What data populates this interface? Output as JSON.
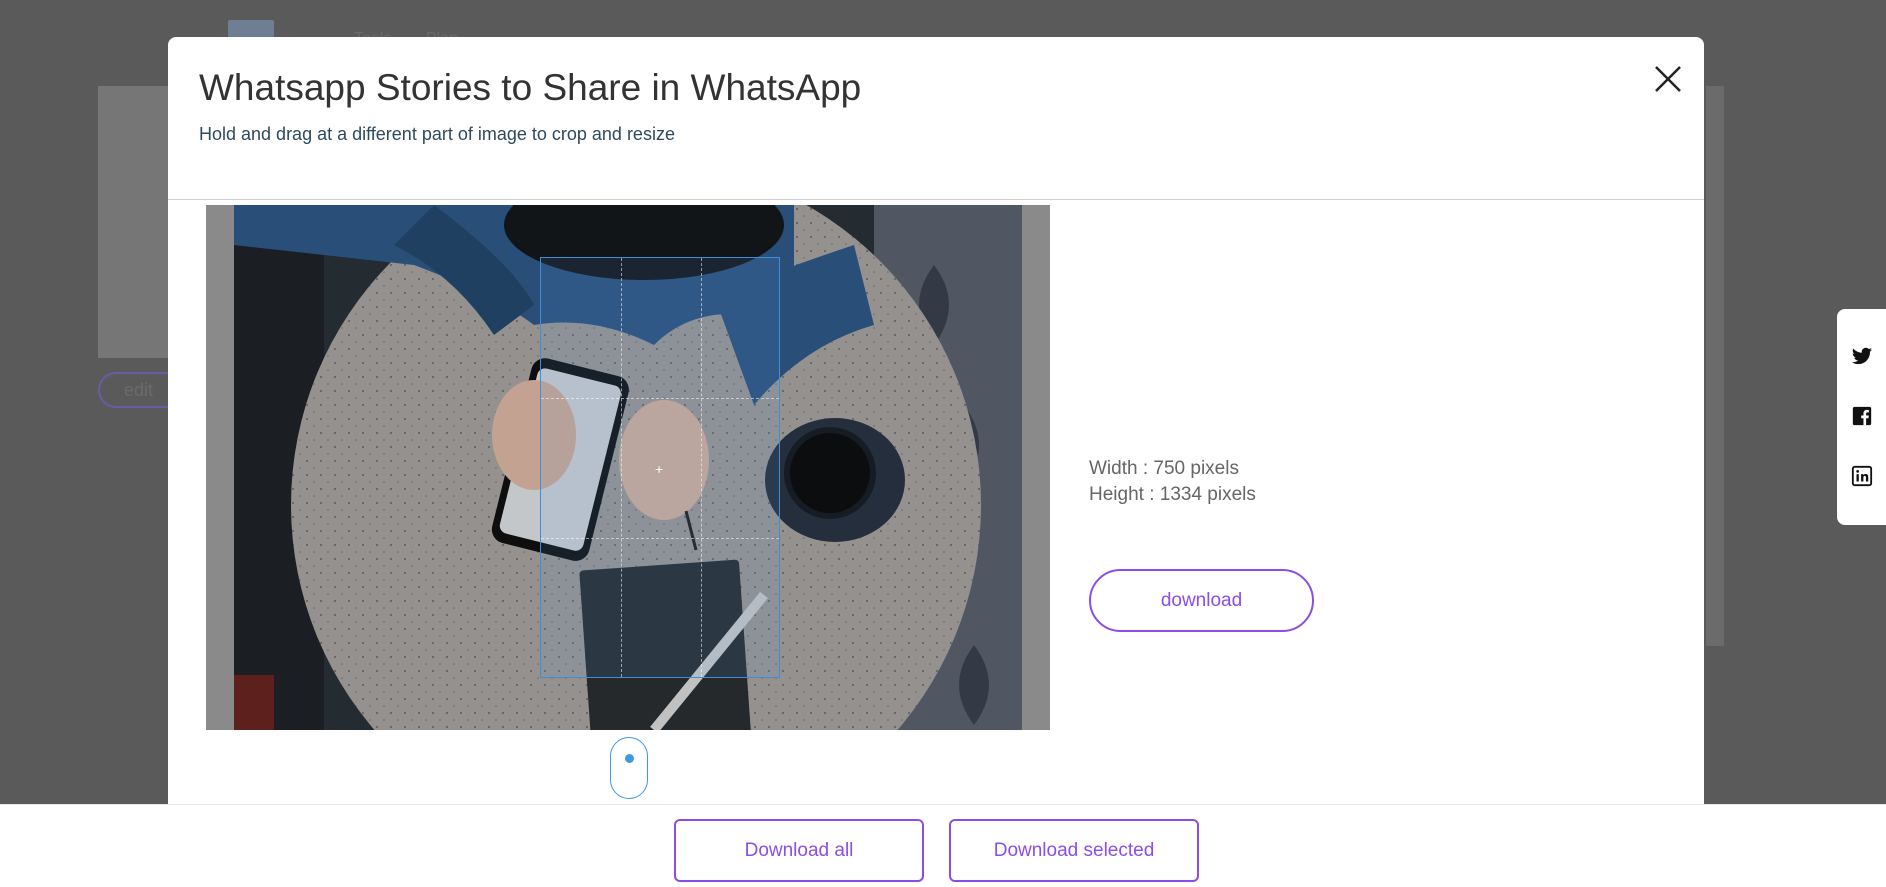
{
  "background": {
    "nav_items": [
      "Tools",
      "Plan"
    ],
    "edit_label": "edit"
  },
  "modal": {
    "title": "Whatsapp Stories to Share in WhatsApp",
    "subtitle": "Hold and drag at a different part of image to crop and resize",
    "close_icon": "close-icon"
  },
  "crop": {
    "center_marker": "+"
  },
  "info": {
    "width_text": "Width : 750 pixels",
    "height_text": "Height : 1334 pixels"
  },
  "actions": {
    "download_label": "download",
    "download_all_label": "Download all",
    "download_selected_label": "Download selected"
  },
  "social": {
    "items": [
      "twitter-icon",
      "facebook-icon",
      "linkedin-icon"
    ]
  },
  "colors": {
    "accent": "#8c4de6",
    "crop_border": "#3d8fd8",
    "overlay": "#595959"
  }
}
